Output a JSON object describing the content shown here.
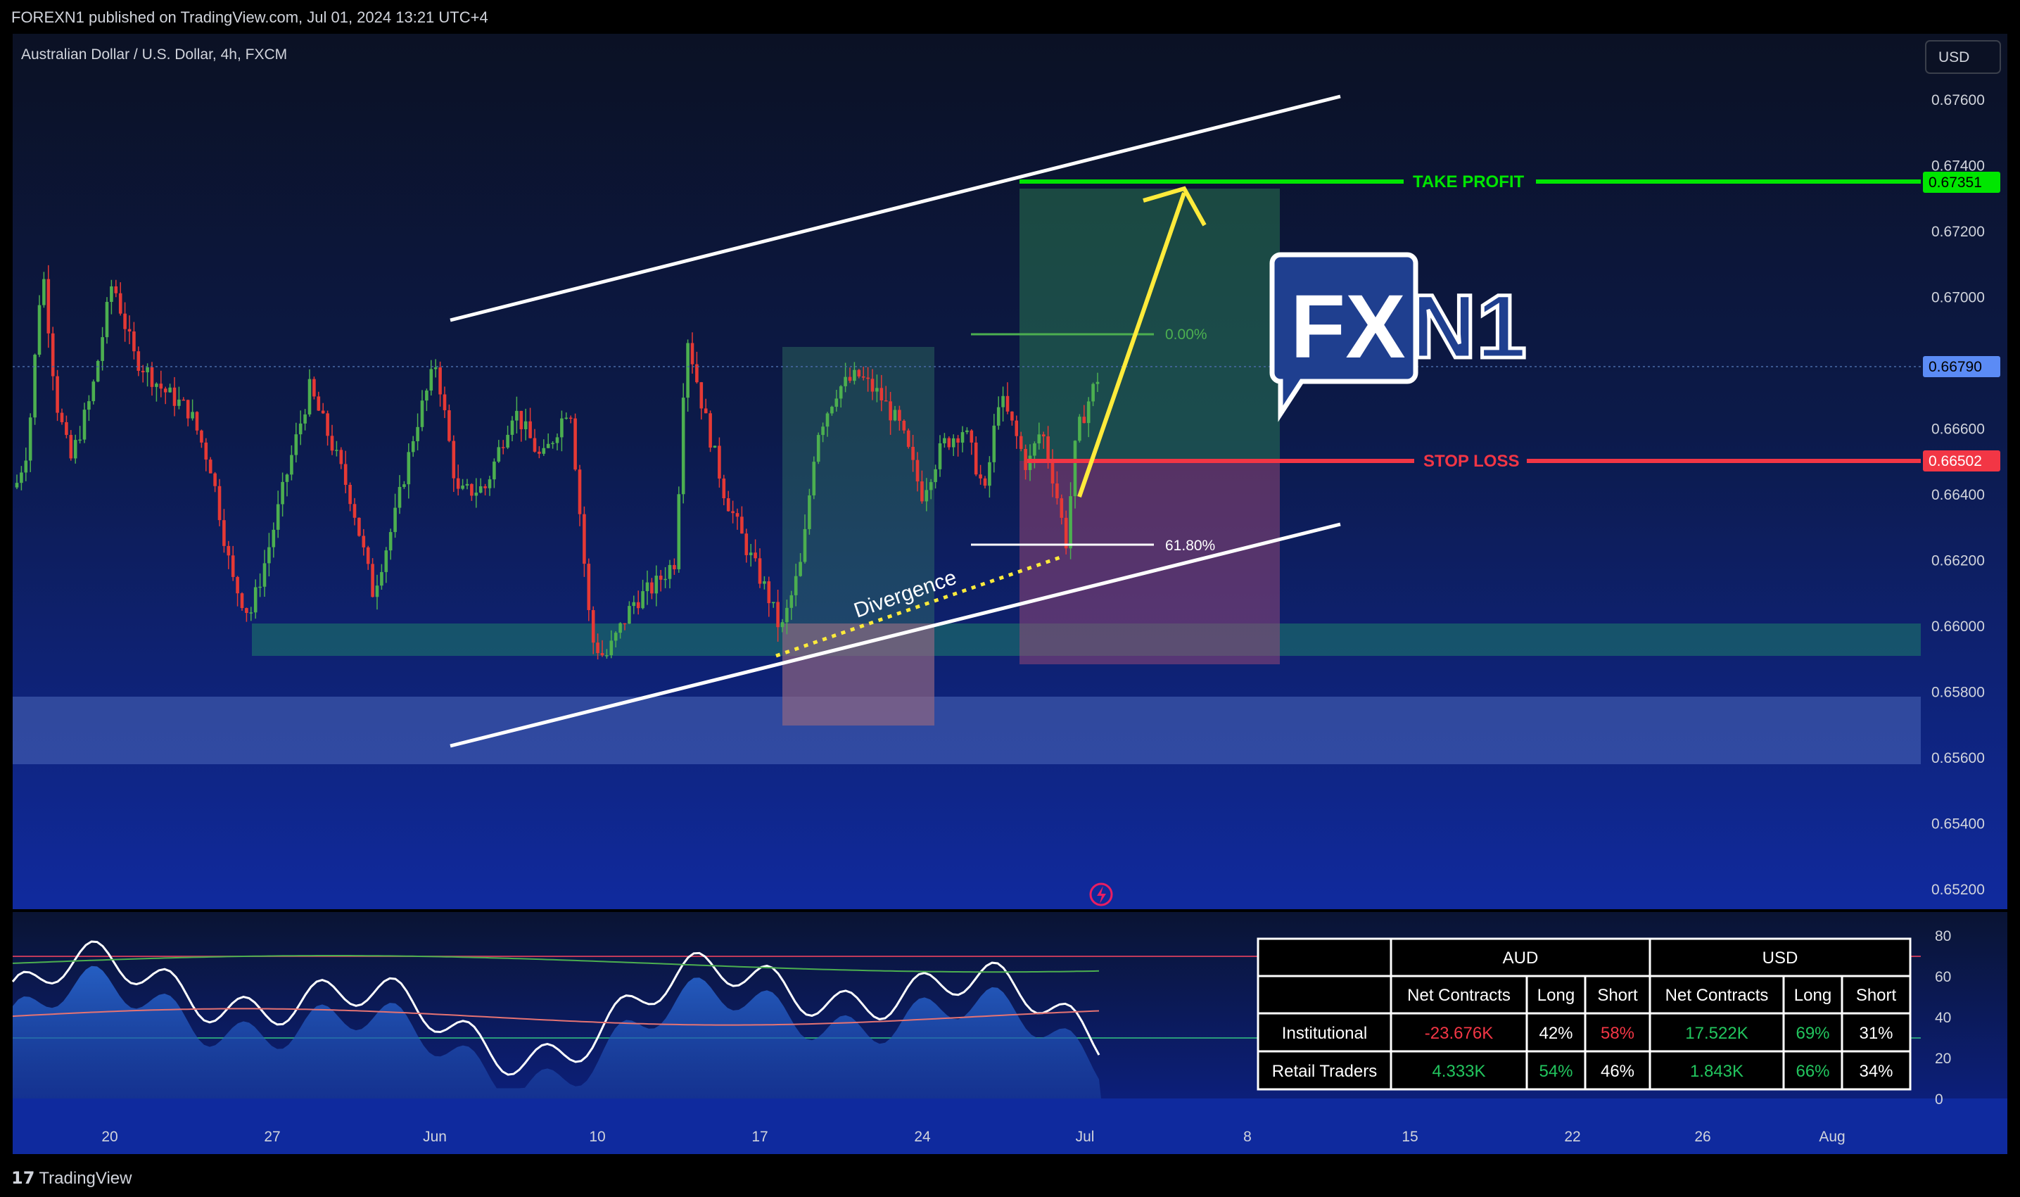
{
  "header": {
    "published": "FOREXN1 published on TradingView.com, Jul 01, 2024 13:21 UTC+4"
  },
  "footer": {
    "brand": "TradingView",
    "brand_mark": "17"
  },
  "chart_data": {
    "type": "candlestick",
    "title": "Australian Dollar / U.S. Dollar, 4h, FXCM",
    "currency": "USD",
    "y_ticks": [
      "0.67600",
      "0.67400",
      "0.67200",
      "0.67000",
      "0.66800",
      "0.66600",
      "0.66400",
      "0.66200",
      "0.66000",
      "0.65800",
      "0.65600",
      "0.65400",
      "0.65200"
    ],
    "ylim": [
      0.6512,
      0.6776
    ],
    "x_ticks": [
      "20",
      "27",
      "Jun",
      "10",
      "17",
      "24",
      "Jul",
      "8",
      "15",
      "22",
      "26",
      "Aug"
    ],
    "price_tags": {
      "take_profit": "0.67351",
      "current": "0.66790",
      "stop_loss": "0.66502"
    },
    "levels": {
      "take_profit_label": "TAKE PROFIT",
      "stop_loss_label": "STOP LOSS",
      "fib_top": "0.00%",
      "fib_bottom": "61.80%"
    },
    "annotations": {
      "divergence": "Divergence"
    },
    "logo": {
      "fx": "FX",
      "n1": "N1"
    },
    "oscillator": {
      "y_ticks": [
        "80",
        "60",
        "40",
        "20",
        "0"
      ],
      "ylim": [
        0,
        85
      ],
      "upper_band": 70,
      "lower_band": 30
    },
    "cot_table": {
      "groups": [
        "AUD",
        "USD"
      ],
      "columns": [
        "Net Contracts",
        "Long",
        "Short",
        "Net Contracts",
        "Long",
        "Short"
      ],
      "rows": [
        {
          "label": "Institutional",
          "cells": [
            "-23.676K",
            "42%",
            "58%",
            "17.522K",
            "69%",
            "31%"
          ]
        },
        {
          "label": "Retail Traders",
          "cells": [
            "4.333K",
            "54%",
            "46%",
            "1.843K",
            "66%",
            "34%"
          ]
        }
      ],
      "colors": {
        "negative": "#f23645",
        "positive": "#22c55e",
        "neutral": "#ffffff"
      }
    },
    "colors": {
      "up": "#4caf50",
      "down": "#e53935",
      "take_profit": "#00e600",
      "stop_loss": "#f23645",
      "current_tag": "#2962ff",
      "arrow": "#ffeb3b",
      "channel": "#ffffff"
    }
  }
}
